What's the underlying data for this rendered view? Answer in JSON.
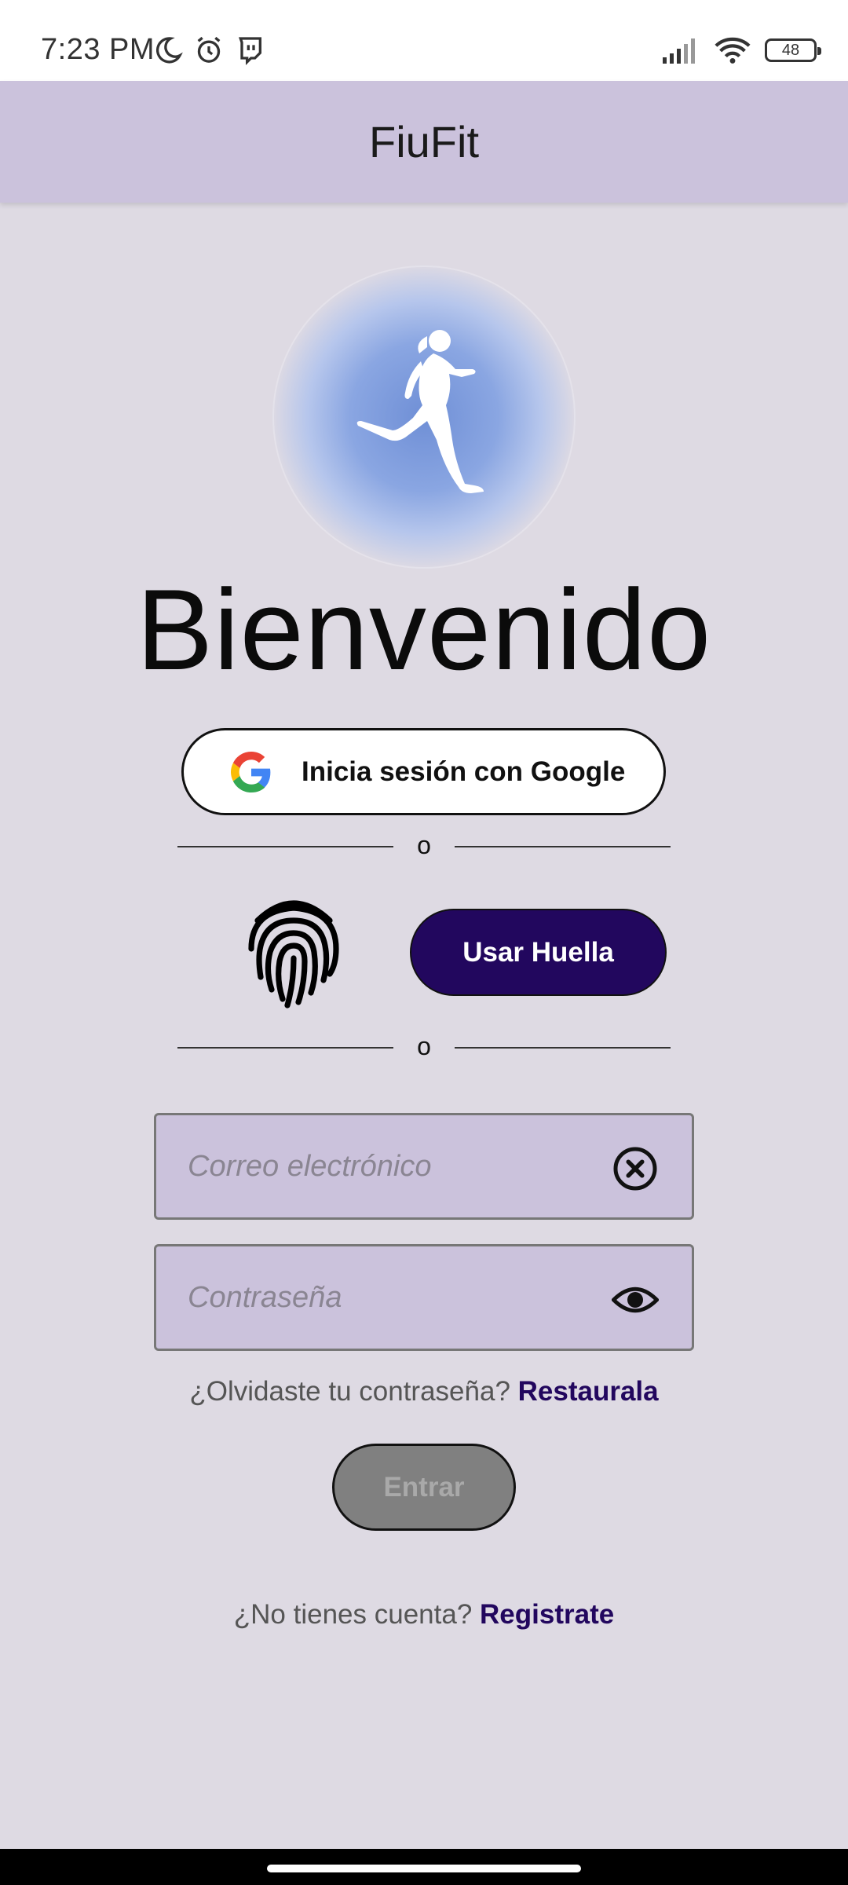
{
  "status_bar": {
    "time": "7:23 PM",
    "left_icons": [
      "moon-icon",
      "alarm-icon",
      "twitch-icon"
    ],
    "right_icons": [
      "signal-icon",
      "wifi-icon",
      "battery-icon"
    ],
    "battery_level": "48"
  },
  "app_bar": {
    "title": "FiuFit"
  },
  "logo": {
    "icon": "runner-icon"
  },
  "welcome_text": "Bienvenido",
  "google_button": {
    "label": "Inicia sesión con Google",
    "icon": "google-icon"
  },
  "divider_text": "o",
  "fingerprint": {
    "icon": "fingerprint-icon",
    "button_label": "Usar Huella"
  },
  "email_field": {
    "placeholder": "Correo electrónico",
    "value": "",
    "icon": "clear-icon"
  },
  "password_field": {
    "placeholder": "Contraseña",
    "value": "",
    "icon": "eye-icon"
  },
  "forgot_password": {
    "text": "¿Olvidaste tu contraseña?",
    "link": "Restaurala"
  },
  "login_button": {
    "label": "Entrar",
    "enabled": false
  },
  "register": {
    "text": "¿No tienes cuenta?",
    "link": "Registrate"
  },
  "colors": {
    "app_bar": "#cbc2dc",
    "background": "#dedae3",
    "primary": "#22075e",
    "disabled_button": "#808080"
  }
}
